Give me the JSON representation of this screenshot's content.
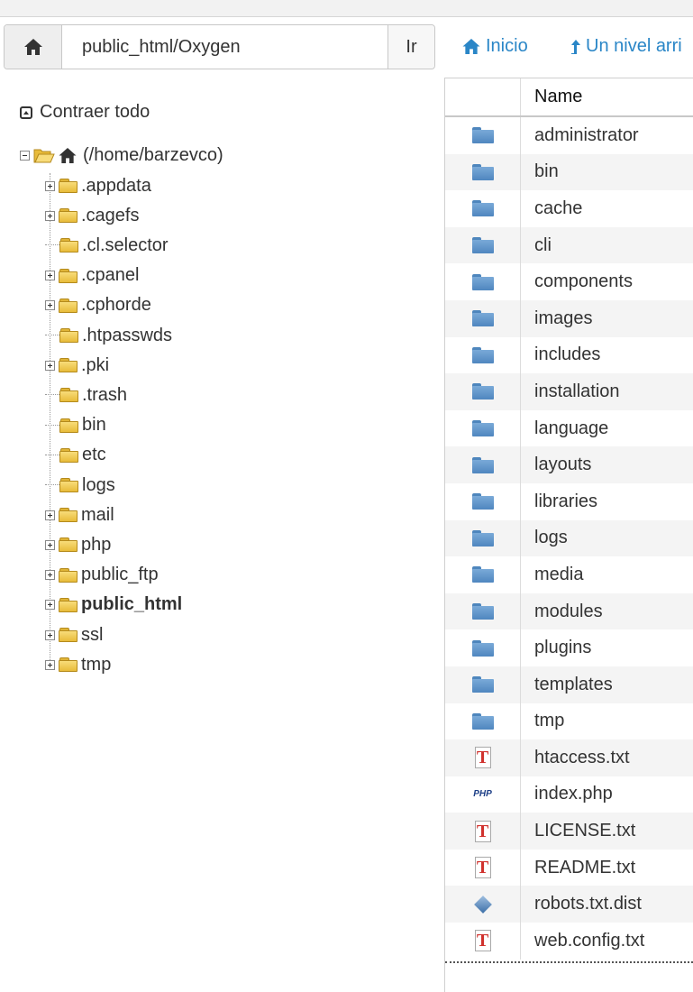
{
  "path_bar": {
    "path_value": "public_html/Oxygen",
    "go_label": "Ir"
  },
  "nav": {
    "home_label": "Inicio",
    "up_label": "Un nivel arri"
  },
  "tree": {
    "collapse_label": "Contraer todo",
    "root_label": "(/home/barzevco)",
    "items": [
      {
        "label": ".appdata",
        "expandable": true
      },
      {
        "label": ".cagefs",
        "expandable": true
      },
      {
        "label": ".cl.selector",
        "expandable": false
      },
      {
        "label": ".cpanel",
        "expandable": true
      },
      {
        "label": ".cphorde",
        "expandable": true
      },
      {
        "label": ".htpasswds",
        "expandable": false
      },
      {
        "label": ".pki",
        "expandable": true
      },
      {
        "label": ".trash",
        "expandable": false
      },
      {
        "label": "bin",
        "expandable": false
      },
      {
        "label": "etc",
        "expandable": false
      },
      {
        "label": "logs",
        "expandable": false
      },
      {
        "label": "mail",
        "expandable": true
      },
      {
        "label": "php",
        "expandable": true
      },
      {
        "label": "public_ftp",
        "expandable": true
      },
      {
        "label": "public_html",
        "expandable": true,
        "selected": true
      },
      {
        "label": "ssl",
        "expandable": true
      },
      {
        "label": "tmp",
        "expandable": true
      }
    ]
  },
  "file_table": {
    "header_name": "Name",
    "rows": [
      {
        "name": "administrator",
        "icon": "folder-icon"
      },
      {
        "name": "bin",
        "icon": "folder-icon"
      },
      {
        "name": "cache",
        "icon": "folder-icon"
      },
      {
        "name": "cli",
        "icon": "folder-icon"
      },
      {
        "name": "components",
        "icon": "folder-icon"
      },
      {
        "name": "images",
        "icon": "folder-icon"
      },
      {
        "name": "includes",
        "icon": "folder-icon"
      },
      {
        "name": "installation",
        "icon": "folder-icon"
      },
      {
        "name": "language",
        "icon": "folder-icon"
      },
      {
        "name": "layouts",
        "icon": "folder-icon"
      },
      {
        "name": "libraries",
        "icon": "folder-icon"
      },
      {
        "name": "logs",
        "icon": "folder-icon"
      },
      {
        "name": "media",
        "icon": "folder-icon"
      },
      {
        "name": "modules",
        "icon": "folder-icon"
      },
      {
        "name": "plugins",
        "icon": "folder-icon"
      },
      {
        "name": "templates",
        "icon": "folder-icon"
      },
      {
        "name": "tmp",
        "icon": "folder-icon"
      },
      {
        "name": "htaccess.txt",
        "icon": "text-file-icon"
      },
      {
        "name": "index.php",
        "icon": "php-file-icon"
      },
      {
        "name": "LICENSE.txt",
        "icon": "text-file-icon"
      },
      {
        "name": "README.txt",
        "icon": "text-file-icon"
      },
      {
        "name": "robots.txt.dist",
        "icon": "generic-file-icon"
      },
      {
        "name": "web.config.txt",
        "icon": "text-file-icon"
      }
    ]
  },
  "colors": {
    "link": "#2a86c7",
    "row_stripe": "#f4f4f4",
    "tree_folder": "#e8bb3a",
    "table_folder": "#4f86bf"
  }
}
